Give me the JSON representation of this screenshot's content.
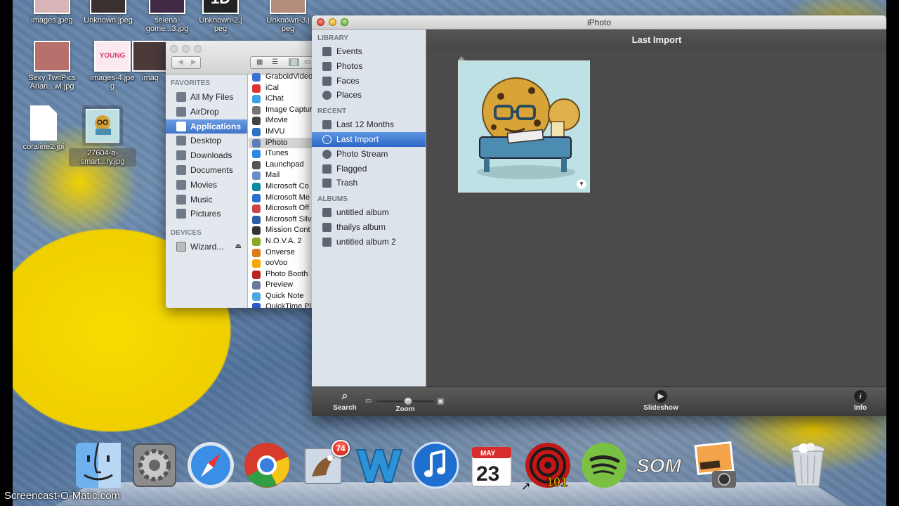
{
  "desktop": {
    "icons": [
      {
        "label": "images.jpeg"
      },
      {
        "label": "Unknown.jpeg"
      },
      {
        "label": "selena-\ngome...3.jpg"
      },
      {
        "label": "Unknown-2.j\npeg"
      },
      {
        "label": "Unknown-3.j\npeg"
      },
      {
        "label": "Sexy TwitPics\nArian...wl.jpg"
      },
      {
        "label": "images-4.jpe\ng"
      },
      {
        "label": "imag"
      },
      {
        "label": "coraline2.jpi"
      },
      {
        "label": "27604-a-\nsmart...ry.jpg"
      }
    ]
  },
  "finder": {
    "favorites_header": "FAVORITES",
    "favorites": [
      {
        "label": "All My Files",
        "icon": "all-files-icon"
      },
      {
        "label": "AirDrop",
        "icon": "airdrop-icon"
      },
      {
        "label": "Applications",
        "icon": "applications-icon",
        "selected": true
      },
      {
        "label": "Desktop",
        "icon": "desktop-icon"
      },
      {
        "label": "Downloads",
        "icon": "downloads-icon"
      },
      {
        "label": "Documents",
        "icon": "documents-icon"
      },
      {
        "label": "Movies",
        "icon": "movies-icon"
      },
      {
        "label": "Music",
        "icon": "music-icon"
      },
      {
        "label": "Pictures",
        "icon": "pictures-icon"
      }
    ],
    "devices_header": "DEVICES",
    "devices": [
      {
        "label": "Wizard...",
        "icon": "disk-icon"
      }
    ],
    "apps": [
      {
        "label": "GraboidVideo",
        "color": "#3a6fd8"
      },
      {
        "label": "iCal",
        "color": "#d33"
      },
      {
        "label": "iChat",
        "color": "#3aa0e8"
      },
      {
        "label": "Image Capture",
        "color": "#777"
      },
      {
        "label": "iMovie",
        "color": "#444"
      },
      {
        "label": "IMVU",
        "color": "#2b72c4"
      },
      {
        "label": "iPhoto",
        "color": "#5a7fb5",
        "selected": true
      },
      {
        "label": "iTunes",
        "color": "#2c8ae6"
      },
      {
        "label": "Launchpad",
        "color": "#555"
      },
      {
        "label": "Mail",
        "color": "#6b8bc9"
      },
      {
        "label": "Microsoft Co",
        "color": "#0a8a9a"
      },
      {
        "label": "Microsoft Me",
        "color": "#2a6fd0"
      },
      {
        "label": "Microsoft Off",
        "color": "#c44"
      },
      {
        "label": "Microsoft Silv",
        "color": "#2b5da8"
      },
      {
        "label": "Mission Cont",
        "color": "#333"
      },
      {
        "label": "N.O.V.A. 2",
        "color": "#8a2"
      },
      {
        "label": "Onverse",
        "color": "#e07b1c"
      },
      {
        "label": "ooVoo",
        "color": "#f2a900"
      },
      {
        "label": "Photo Booth",
        "color": "#b22"
      },
      {
        "label": "Preview",
        "color": "#6a7a9a"
      },
      {
        "label": "Quick Note",
        "color": "#4aa8e0"
      },
      {
        "label": "QuickTime Pl",
        "color": "#2b5ac9"
      }
    ]
  },
  "iphoto": {
    "window_title": "iPhoto",
    "library_header": "LIBRARY",
    "library": [
      {
        "label": "Events",
        "icon": "events-icon"
      },
      {
        "label": "Photos",
        "icon": "photos-icon"
      },
      {
        "label": "Faces",
        "icon": "faces-icon"
      },
      {
        "label": "Places",
        "icon": "places-icon"
      }
    ],
    "recent_header": "RECENT",
    "recent": [
      {
        "label": "Last 12 Months",
        "icon": "calendar-icon"
      },
      {
        "label": "Last Import",
        "icon": "clock-icon",
        "selected": true
      },
      {
        "label": "Photo Stream",
        "icon": "photo-stream-icon"
      },
      {
        "label": "Flagged",
        "icon": "flag-icon"
      },
      {
        "label": "Trash",
        "icon": "trash-icon"
      }
    ],
    "albums_header": "ALBUMS",
    "albums": [
      {
        "label": "untitled album",
        "icon": "album-icon"
      },
      {
        "label": "thailys album",
        "icon": "album-icon"
      },
      {
        "label": "untitled album 2",
        "icon": "album-icon"
      }
    ],
    "main_title": "Last Import",
    "toolbar": {
      "search_label": "Search",
      "zoom_label": "Zoom",
      "zoom_level": 0.55,
      "slideshow_label": "Slideshow",
      "info_label": "Info",
      "info_glyph": "i"
    }
  },
  "dock": {
    "apps": [
      {
        "name": "finder-icon"
      },
      {
        "name": "system-preferences-icon"
      },
      {
        "name": "safari-icon"
      },
      {
        "name": "chrome-icon"
      },
      {
        "name": "mail-icon",
        "badge": "74"
      },
      {
        "name": "word-w-icon"
      },
      {
        "name": "itunes-icon"
      },
      {
        "name": "calendar-icon",
        "month": "MAY",
        "day": "23"
      },
      {
        "name": "radio-101-icon",
        "text": "101"
      },
      {
        "name": "spotify-icon"
      },
      {
        "name": "som-icon",
        "text": "SOM"
      },
      {
        "name": "iphoto-icon"
      },
      {
        "name": "trash-icon"
      }
    ]
  },
  "watermark": "Screencast-O-Matic.com"
}
